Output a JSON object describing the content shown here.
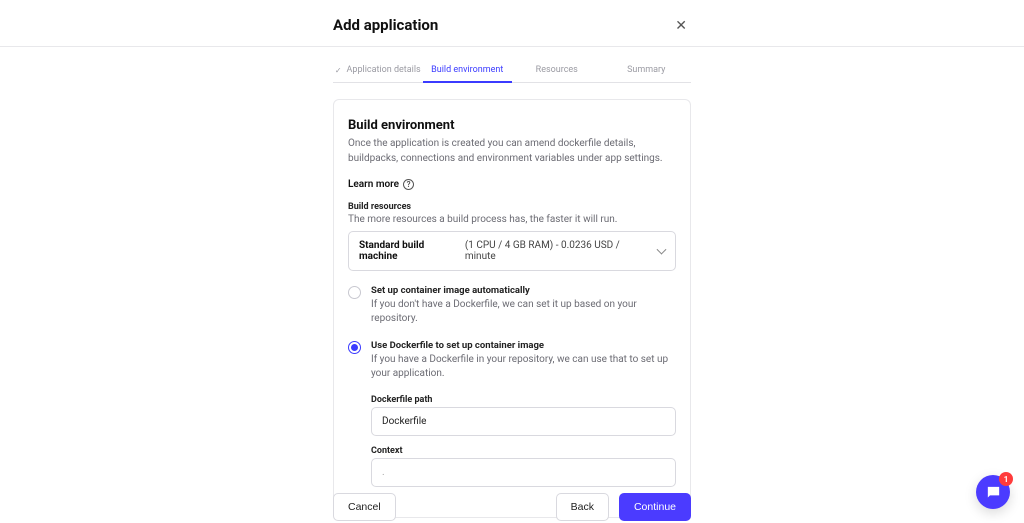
{
  "modal": {
    "title": "Add application",
    "close_aria": "Close"
  },
  "steps": {
    "s1": "Application details",
    "s2": "Build environment",
    "s3": "Resources",
    "s4": "Summary"
  },
  "section": {
    "title": "Build environment",
    "desc": "Once the application is created you can amend dockerfile details, buildpacks, connections and environment variables under app settings.",
    "learn_more": "Learn more"
  },
  "build_resources": {
    "label": "Build resources",
    "desc": "The more resources a build process has, the faster it will run.",
    "selected_name": "Standard build machine",
    "selected_rest": "(1 CPU / 4 GB RAM) - 0.0236 USD / minute"
  },
  "options": {
    "auto": {
      "title": "Set up container image automatically",
      "desc": "If you don't have a Dockerfile, we can set it up based on your repository."
    },
    "dockerfile": {
      "title": "Use Dockerfile to set up container image",
      "desc": "If you have a Dockerfile in your repository, we can use that to set up your application.",
      "path_label": "Dockerfile path",
      "path_value": "Dockerfile",
      "context_label": "Context",
      "context_placeholder": "."
    }
  },
  "footer": {
    "cancel": "Cancel",
    "back": "Back",
    "continue": "Continue"
  },
  "chat": {
    "badge": "1"
  }
}
